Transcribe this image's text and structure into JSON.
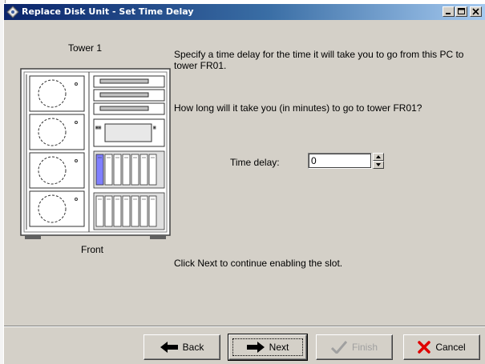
{
  "window": {
    "title": "Replace Disk Unit - Set Time Delay",
    "controls": [
      "minimize",
      "maximize",
      "close"
    ]
  },
  "illustration": {
    "top_label": "Tower 1",
    "bottom_label": "Front"
  },
  "instructions": {
    "line1": "Specify a time delay for the time it will take you to go from this PC to tower FR01.",
    "question": "How long will it take you (in minutes) to go to tower FR01?",
    "footer": "Click Next to continue enabling the slot."
  },
  "time_delay": {
    "label": "Time delay:",
    "value": "0"
  },
  "buttons": {
    "back": "Back",
    "next": "Next",
    "finish": "Finish",
    "cancel": "Cancel"
  },
  "colors": {
    "title_bar_start": "#0a246a",
    "title_bar_end": "#a6caf0",
    "dialog_bg": "#d4d0c8",
    "cancel_x": "#e00000",
    "arrow_icon": "#000000",
    "finish_check_disabled": "#a0a0a0"
  },
  "icons": {
    "title": "app-diamond-icon",
    "back": "left-arrow-icon",
    "next": "right-arrow-icon",
    "finish": "checkmark-icon",
    "cancel": "red-x-icon"
  }
}
